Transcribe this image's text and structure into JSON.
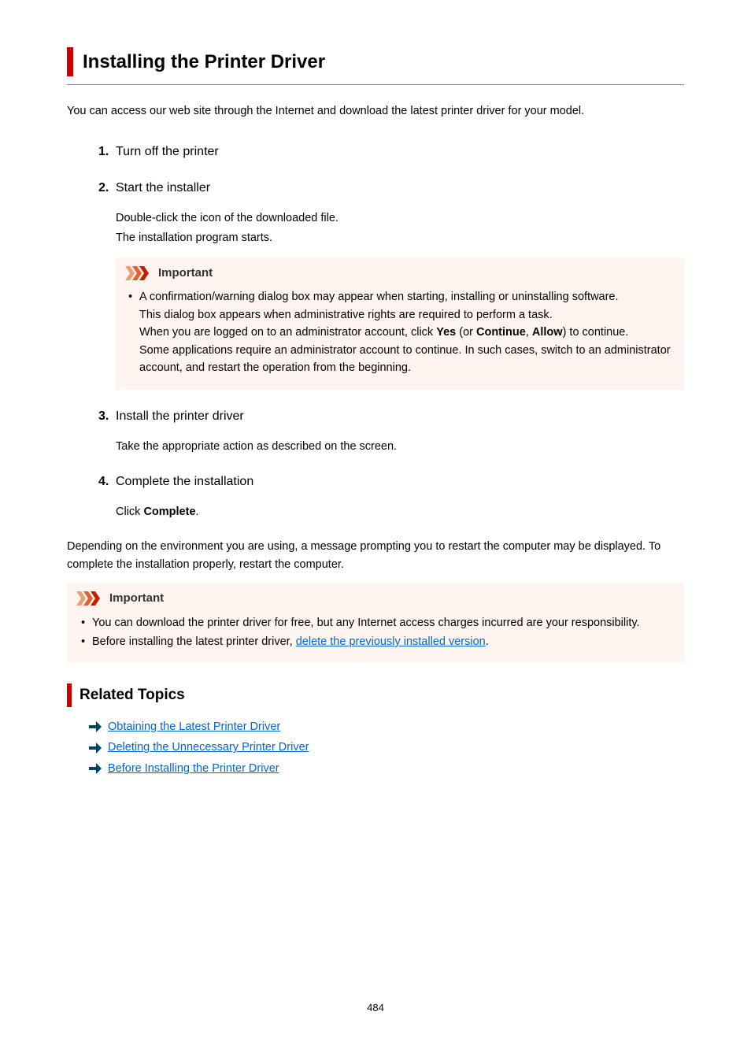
{
  "title": "Installing the Printer Driver",
  "intro": "You can access our web site through the Internet and download the latest printer driver for your model.",
  "steps": [
    {
      "num": "1.",
      "title": "Turn off the printer"
    },
    {
      "num": "2.",
      "title": "Start the installer",
      "body": [
        "Double-click the icon of the downloaded file.",
        "The installation program starts."
      ],
      "callout": {
        "heading": "Important",
        "items": [
          {
            "lines": [
              "A confirmation/warning dialog box may appear when starting, installing or uninstalling software.",
              "This dialog box appears when administrative rights are required to perform a task.",
              {
                "pre": "When you are logged on to an administrator account, click ",
                "b1": "Yes",
                "mid1": " (or ",
                "b2": "Continue",
                "mid2": ", ",
                "b3": "Allow",
                "post": ") to continue."
              },
              "Some applications require an administrator account to continue. In such cases, switch to an administrator account, and restart the operation from the beginning."
            ]
          }
        ]
      }
    },
    {
      "num": "3.",
      "title": "Install the printer driver",
      "body": [
        "Take the appropriate action as described on the screen."
      ]
    },
    {
      "num": "4.",
      "title": "Complete the installation",
      "body_rich": {
        "pre": "Click ",
        "b": "Complete",
        "post": "."
      }
    }
  ],
  "after_steps": "Depending on the environment you are using, a message prompting you to restart the computer may be displayed. To complete the installation properly, restart the computer.",
  "outer_callout": {
    "heading": "Important",
    "items": [
      "You can download the printer driver for free, but any Internet access charges incurred are your responsibility.",
      {
        "pre": "Before installing the latest printer driver, ",
        "link": "delete the previously installed version",
        "post": "."
      }
    ]
  },
  "related": {
    "heading": "Related Topics",
    "links": [
      "Obtaining the Latest Printer Driver",
      "Deleting the Unnecessary Printer Driver",
      "Before Installing the Printer Driver"
    ]
  },
  "page_number": "484"
}
